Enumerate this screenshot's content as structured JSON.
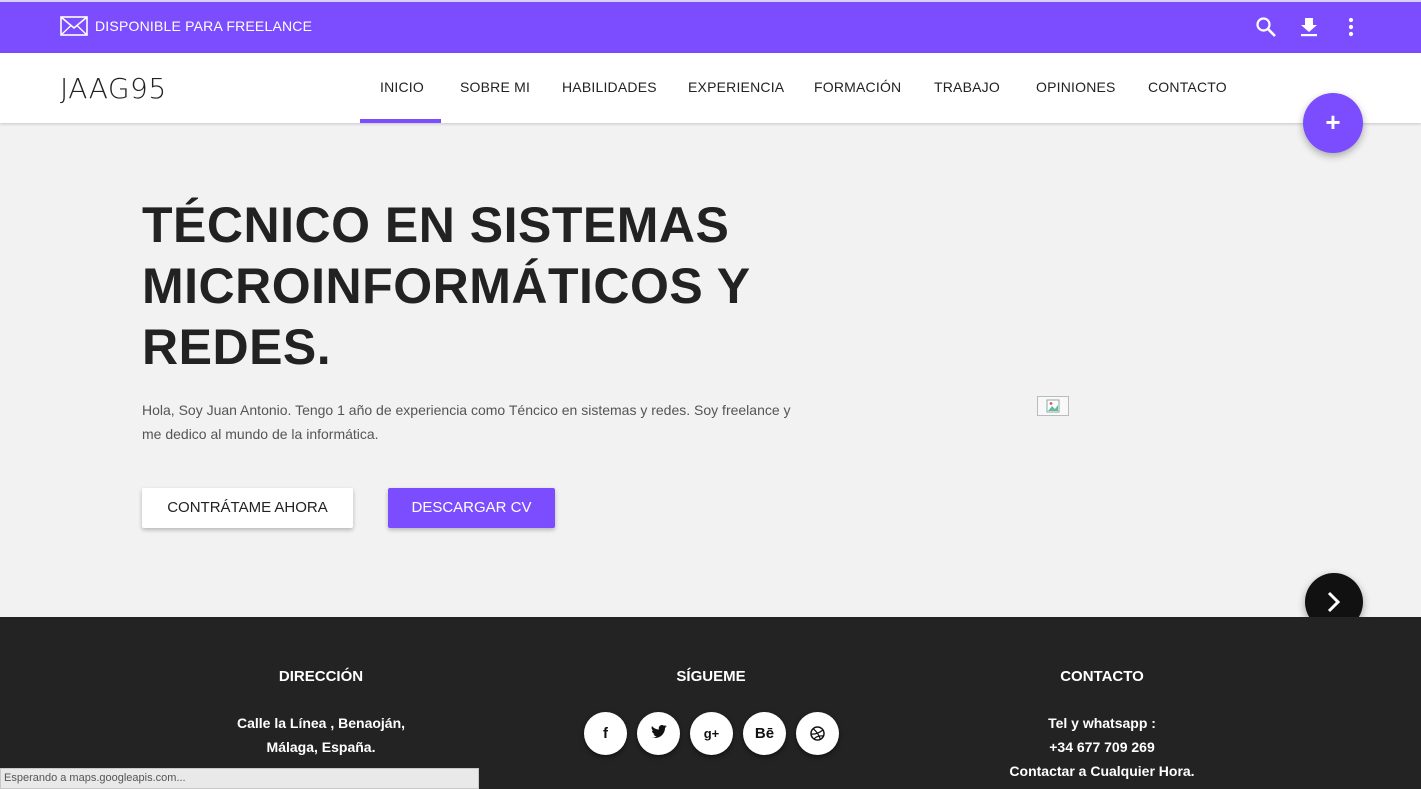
{
  "topbar": {
    "freelance_text": "DISPONIBLE PARA FREELANCE",
    "icons": [
      "mail-icon",
      "search-icon",
      "download-icon",
      "more-vert-icon"
    ],
    "color": "#7c4dff"
  },
  "nav": {
    "logo": "JAAG95",
    "items": [
      "INICIO",
      "SOBRE MI",
      "HABILIDADES",
      "EXPERIENCIA",
      "FORMACIÓN",
      "TRABAJO",
      "OPINIONES",
      "CONTACTO"
    ],
    "active": "INICIO"
  },
  "fab": {
    "plus": "+",
    "icons": [
      "plus-icon",
      "chevron-right-icon",
      "chevron-left-icon"
    ]
  },
  "hero": {
    "title_lines": [
      "TÉCNICO EN SISTEMAS",
      "MICROINFORMÁTICOS Y",
      "REDES."
    ],
    "text_lines": [
      "Hola, Soy Juan Antonio. Tengo 1 año de experiencia como Téncico en sistemas y redes. Soy freelance y",
      "me dedico al mundo de la informática."
    ],
    "btn_hire": "CONTRÁTAME AHORA",
    "btn_cv": "DESCARGAR CV"
  },
  "footer": {
    "direccion": {
      "title": "DIRECCIÓN",
      "lines": [
        "Calle la Línea , Benaoján,",
        "Málaga, España."
      ]
    },
    "sigueme": {
      "title": "SÍGUEME",
      "social": [
        "f",
        "g+",
        "Bē"
      ],
      "social_icons": [
        "facebook-icon",
        "twitter-icon",
        "google-plus-icon",
        "behance-icon",
        "dribbble-icon"
      ]
    },
    "contacto": {
      "title": "CONTACTO",
      "lines": [
        "Tel y whatsapp :",
        "+34 677 709 269",
        "Contactar a Cualquier Hora."
      ]
    }
  },
  "status_bar": "Esperando a maps.googleapis.com..."
}
